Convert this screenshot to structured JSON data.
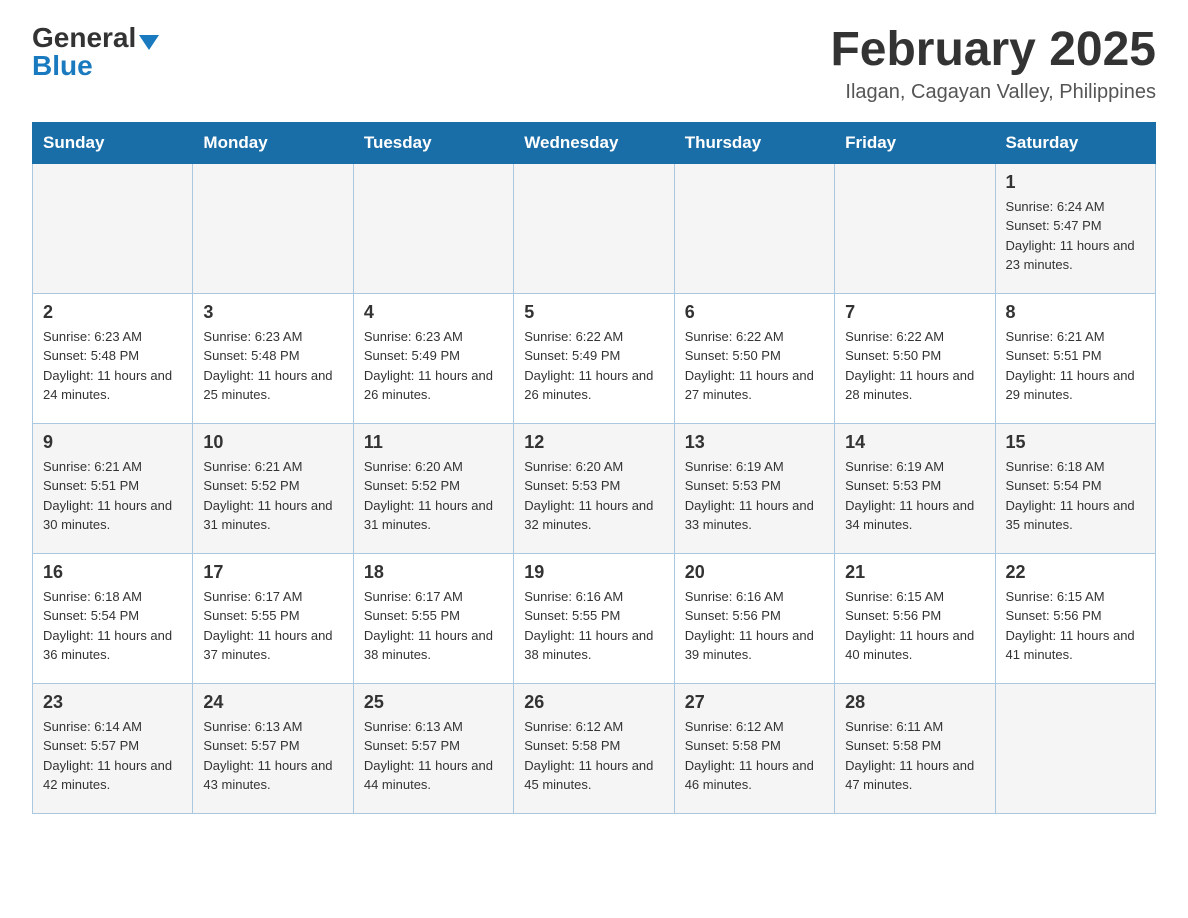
{
  "logo": {
    "general": "General",
    "triangle": "▼",
    "blue": "Blue"
  },
  "header": {
    "month_year": "February 2025",
    "location": "Ilagan, Cagayan Valley, Philippines"
  },
  "days_of_week": [
    "Sunday",
    "Monday",
    "Tuesday",
    "Wednesday",
    "Thursday",
    "Friday",
    "Saturday"
  ],
  "weeks": [
    [
      null,
      null,
      null,
      null,
      null,
      null,
      {
        "day": "1",
        "sunrise": "Sunrise: 6:24 AM",
        "sunset": "Sunset: 5:47 PM",
        "daylight": "Daylight: 11 hours and 23 minutes."
      }
    ],
    [
      {
        "day": "2",
        "sunrise": "Sunrise: 6:23 AM",
        "sunset": "Sunset: 5:48 PM",
        "daylight": "Daylight: 11 hours and 24 minutes."
      },
      {
        "day": "3",
        "sunrise": "Sunrise: 6:23 AM",
        "sunset": "Sunset: 5:48 PM",
        "daylight": "Daylight: 11 hours and 25 minutes."
      },
      {
        "day": "4",
        "sunrise": "Sunrise: 6:23 AM",
        "sunset": "Sunset: 5:49 PM",
        "daylight": "Daylight: 11 hours and 26 minutes."
      },
      {
        "day": "5",
        "sunrise": "Sunrise: 6:22 AM",
        "sunset": "Sunset: 5:49 PM",
        "daylight": "Daylight: 11 hours and 26 minutes."
      },
      {
        "day": "6",
        "sunrise": "Sunrise: 6:22 AM",
        "sunset": "Sunset: 5:50 PM",
        "daylight": "Daylight: 11 hours and 27 minutes."
      },
      {
        "day": "7",
        "sunrise": "Sunrise: 6:22 AM",
        "sunset": "Sunset: 5:50 PM",
        "daylight": "Daylight: 11 hours and 28 minutes."
      },
      {
        "day": "8",
        "sunrise": "Sunrise: 6:21 AM",
        "sunset": "Sunset: 5:51 PM",
        "daylight": "Daylight: 11 hours and 29 minutes."
      }
    ],
    [
      {
        "day": "9",
        "sunrise": "Sunrise: 6:21 AM",
        "sunset": "Sunset: 5:51 PM",
        "daylight": "Daylight: 11 hours and 30 minutes."
      },
      {
        "day": "10",
        "sunrise": "Sunrise: 6:21 AM",
        "sunset": "Sunset: 5:52 PM",
        "daylight": "Daylight: 11 hours and 31 minutes."
      },
      {
        "day": "11",
        "sunrise": "Sunrise: 6:20 AM",
        "sunset": "Sunset: 5:52 PM",
        "daylight": "Daylight: 11 hours and 31 minutes."
      },
      {
        "day": "12",
        "sunrise": "Sunrise: 6:20 AM",
        "sunset": "Sunset: 5:53 PM",
        "daylight": "Daylight: 11 hours and 32 minutes."
      },
      {
        "day": "13",
        "sunrise": "Sunrise: 6:19 AM",
        "sunset": "Sunset: 5:53 PM",
        "daylight": "Daylight: 11 hours and 33 minutes."
      },
      {
        "day": "14",
        "sunrise": "Sunrise: 6:19 AM",
        "sunset": "Sunset: 5:53 PM",
        "daylight": "Daylight: 11 hours and 34 minutes."
      },
      {
        "day": "15",
        "sunrise": "Sunrise: 6:18 AM",
        "sunset": "Sunset: 5:54 PM",
        "daylight": "Daylight: 11 hours and 35 minutes."
      }
    ],
    [
      {
        "day": "16",
        "sunrise": "Sunrise: 6:18 AM",
        "sunset": "Sunset: 5:54 PM",
        "daylight": "Daylight: 11 hours and 36 minutes."
      },
      {
        "day": "17",
        "sunrise": "Sunrise: 6:17 AM",
        "sunset": "Sunset: 5:55 PM",
        "daylight": "Daylight: 11 hours and 37 minutes."
      },
      {
        "day": "18",
        "sunrise": "Sunrise: 6:17 AM",
        "sunset": "Sunset: 5:55 PM",
        "daylight": "Daylight: 11 hours and 38 minutes."
      },
      {
        "day": "19",
        "sunrise": "Sunrise: 6:16 AM",
        "sunset": "Sunset: 5:55 PM",
        "daylight": "Daylight: 11 hours and 38 minutes."
      },
      {
        "day": "20",
        "sunrise": "Sunrise: 6:16 AM",
        "sunset": "Sunset: 5:56 PM",
        "daylight": "Daylight: 11 hours and 39 minutes."
      },
      {
        "day": "21",
        "sunrise": "Sunrise: 6:15 AM",
        "sunset": "Sunset: 5:56 PM",
        "daylight": "Daylight: 11 hours and 40 minutes."
      },
      {
        "day": "22",
        "sunrise": "Sunrise: 6:15 AM",
        "sunset": "Sunset: 5:56 PM",
        "daylight": "Daylight: 11 hours and 41 minutes."
      }
    ],
    [
      {
        "day": "23",
        "sunrise": "Sunrise: 6:14 AM",
        "sunset": "Sunset: 5:57 PM",
        "daylight": "Daylight: 11 hours and 42 minutes."
      },
      {
        "day": "24",
        "sunrise": "Sunrise: 6:13 AM",
        "sunset": "Sunset: 5:57 PM",
        "daylight": "Daylight: 11 hours and 43 minutes."
      },
      {
        "day": "25",
        "sunrise": "Sunrise: 6:13 AM",
        "sunset": "Sunset: 5:57 PM",
        "daylight": "Daylight: 11 hours and 44 minutes."
      },
      {
        "day": "26",
        "sunrise": "Sunrise: 6:12 AM",
        "sunset": "Sunset: 5:58 PM",
        "daylight": "Daylight: 11 hours and 45 minutes."
      },
      {
        "day": "27",
        "sunrise": "Sunrise: 6:12 AM",
        "sunset": "Sunset: 5:58 PM",
        "daylight": "Daylight: 11 hours and 46 minutes."
      },
      {
        "day": "28",
        "sunrise": "Sunrise: 6:11 AM",
        "sunset": "Sunset: 5:58 PM",
        "daylight": "Daylight: 11 hours and 47 minutes."
      },
      null
    ]
  ]
}
